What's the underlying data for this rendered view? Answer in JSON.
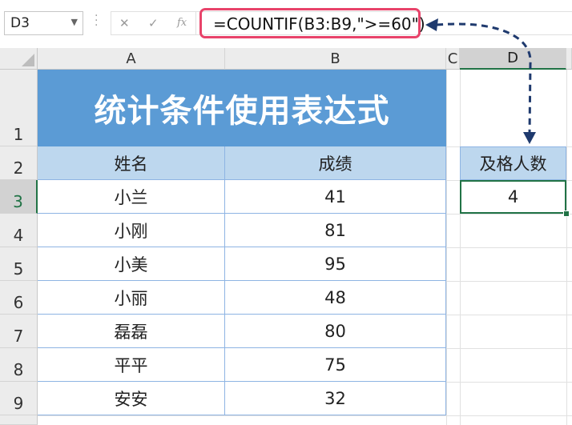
{
  "formula_bar": {
    "name_box": "D3",
    "cancel_icon": "✕",
    "enter_icon": "✓",
    "fx_label": "fx",
    "formula": "=COUNTIF(B3:B9,\">=60\")"
  },
  "columns": [
    "A",
    "B",
    "C",
    "D"
  ],
  "rows": [
    "1",
    "2",
    "3",
    "4",
    "5",
    "6",
    "7",
    "8",
    "9"
  ],
  "sheet": {
    "title": "统计条件使用表达式",
    "headers": {
      "name": "姓名",
      "score": "成绩"
    },
    "records": [
      {
        "name": "小兰",
        "score": "41"
      },
      {
        "name": "小刚",
        "score": "81"
      },
      {
        "name": "小美",
        "score": "95"
      },
      {
        "name": "小丽",
        "score": "48"
      },
      {
        "name": "磊磊",
        "score": "80"
      },
      {
        "name": "平平",
        "score": "75"
      },
      {
        "name": "安安",
        "score": "32"
      }
    ],
    "result_header": "及格人数",
    "result_value": "4"
  },
  "colors": {
    "title_fill": "#5b9bd5",
    "header_fill": "#bdd7ee",
    "selection": "#217346",
    "formula_highlight": "#e8436a",
    "arrow": "#1f3a6e"
  }
}
